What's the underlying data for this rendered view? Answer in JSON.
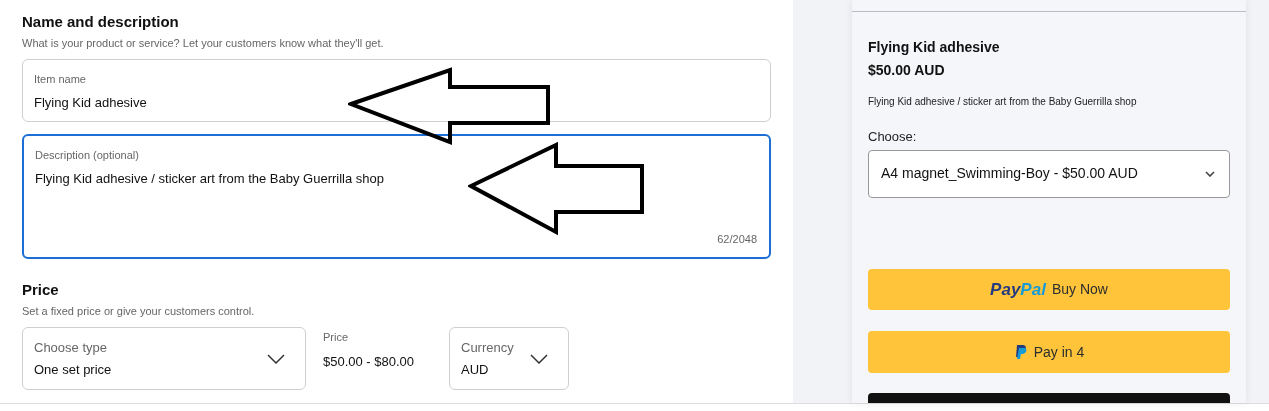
{
  "name_section": {
    "title": "Name and description",
    "subtitle": "What is your product or service? Let your customers know what they'll get.",
    "fields": [
      {
        "kind": "input",
        "label": "Item name",
        "value": "Flying Kid adhesive",
        "focused": false
      },
      {
        "kind": "textarea",
        "label": "Description (optional)",
        "value": "Flying Kid adhesive / sticker art from the Baby Guerrilla shop",
        "counter": "62/2048",
        "focused": true
      }
    ]
  },
  "price_section": {
    "title": "Price",
    "subtitle": "Set a fixed price or give your customers control.",
    "type_select": {
      "label": "Choose type",
      "value": "One set price"
    },
    "price": {
      "label": "Price",
      "value": "$50.00 - $80.00"
    },
    "currency_select": {
      "label": "Currency",
      "value": "AUD"
    }
  },
  "preview": {
    "title": "Flying Kid adhesive",
    "price": "$50.00 AUD",
    "description": "Flying Kid adhesive / sticker art from the Baby Guerrilla shop",
    "choose_label": "Choose:",
    "option": "A4 magnet_Swimming-Boy - $50.00 AUD",
    "buttons": [
      {
        "kind": "buy_now",
        "logo_first": "Pay",
        "logo_second": "Pal",
        "label": "Buy Now"
      },
      {
        "kind": "pay_in_4",
        "label": "Pay in 4"
      },
      {
        "kind": "dark"
      }
    ]
  }
}
